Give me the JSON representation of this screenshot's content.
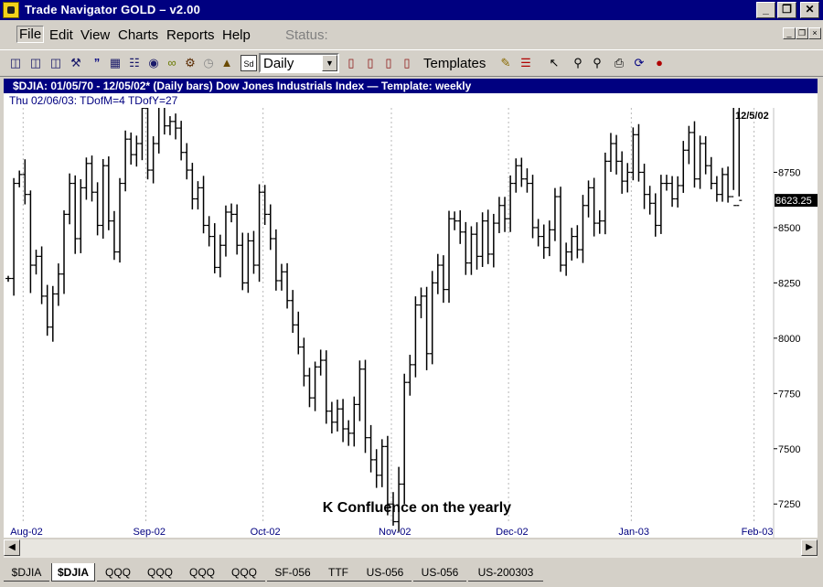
{
  "window": {
    "title": "Trade Navigator GOLD – v2.00"
  },
  "menu": {
    "items": [
      "File",
      "Edit",
      "View",
      "Charts",
      "Reports",
      "Help"
    ],
    "status_label": "Status:"
  },
  "toolbar": {
    "period_value": "Daily",
    "templates_label": "Templates",
    "icons": [
      "zoom-in-icon",
      "zoom-out-icon",
      "zoom-fit-icon",
      "tools-icon",
      "quotes-icon",
      "grid-icon",
      "print-preview-icon",
      "camera-icon",
      "link-icon",
      "gear-icon",
      "clock-icon",
      "hat-icon",
      "sd-icon",
      "bars-1-icon",
      "bars-2-icon",
      "bars-3-icon",
      "bars-4-icon",
      "pencil-icon",
      "lines-icon",
      "cursor-icon",
      "magnify-plus-icon",
      "magnify-minus-icon",
      "printer-icon",
      "refresh-icon",
      "traffic-light-icon"
    ]
  },
  "chart_header": {
    "title": "$DJIA:  01/05/70 - 12/05/02*  (Daily bars)   Dow Jones Industrials Index  —  Template: weekly",
    "info": "Thu   02/06/03:  TDofM=4   TDofY=27"
  },
  "chart_data": {
    "type": "ohlc",
    "title": "",
    "xlabel": "",
    "ylabel": "",
    "ylim": [
      7160,
      9000
    ],
    "yticks": [
      7250,
      7500,
      7750,
      8000,
      8250,
      8500,
      8750
    ],
    "xticks": [
      {
        "label": "Aug-02",
        "bar": 3
      },
      {
        "label": "Sep-02",
        "bar": 25
      },
      {
        "label": "Oct-02",
        "bar": 46
      },
      {
        "label": "Nov-02",
        "bar": 69
      },
      {
        "label": "Dec-02",
        "bar": 90
      },
      {
        "label": "Jan-03",
        "bar": 112
      },
      {
        "label": "Feb-03",
        "bar": 134
      }
    ],
    "x_total_bars": 138,
    "last_date_label": "12/5/02",
    "last_price": "8623.25",
    "annotation": {
      "text": "K      Confluence on the  yearly",
      "bar": 57
    },
    "grid": true,
    "closes": [
      8270,
      8700,
      8740,
      8650,
      8330,
      8370,
      8190,
      8050,
      8200,
      8290,
      8560,
      8700,
      8450,
      8680,
      8790,
      8660,
      8510,
      8780,
      8530,
      8390,
      8700,
      8900,
      8830,
      8880,
      9040,
      8760,
      8880,
      9090,
      8960,
      8980,
      8950,
      8840,
      8760,
      8630,
      8680,
      8510,
      8460,
      8320,
      8420,
      8570,
      8560,
      8420,
      8250,
      8440,
      8330,
      8660,
      8560,
      8450,
      8260,
      8300,
      8170,
      8060,
      7960,
      7830,
      7730,
      7870,
      7900,
      7670,
      7620,
      7680,
      7590,
      7570,
      7700,
      7860,
      7550,
      7450,
      7380,
      7510,
      7250,
      7170,
      7340,
      7800,
      7880,
      8150,
      8190,
      7930,
      8250,
      8330,
      8220,
      8540,
      8530,
      8480,
      8340,
      8470,
      8370,
      8530,
      8380,
      8520,
      8600,
      8540,
      8700,
      8780,
      8720,
      8700,
      8500,
      8460,
      8410,
      8490,
      8640,
      8330,
      8390,
      8460,
      8400,
      8600,
      8680,
      8520,
      8530,
      8800,
      8880,
      8800,
      8710,
      8750,
      8920,
      8750,
      8650,
      8610,
      8510,
      8700,
      8700,
      8630,
      8690,
      8850,
      8930,
      8720,
      8880,
      8780,
      8700,
      8650,
      8740,
      8640,
      8600,
      8623
    ],
    "lows_offset": [
      50,
      260,
      60,
      150,
      420,
      140,
      120,
      130,
      220,
      180,
      300,
      150,
      230,
      220,
      180,
      140,
      150,
      200,
      140,
      120,
      160,
      120,
      150,
      180,
      250,
      140,
      200,
      150,
      130,
      140,
      170,
      120,
      140,
      160,
      160,
      120,
      150,
      90,
      150,
      170,
      120,
      140,
      110,
      150,
      130,
      250,
      160,
      170,
      150,
      150,
      120,
      120,
      110,
      160,
      140,
      200,
      130,
      190,
      170,
      140,
      200,
      190,
      200,
      250,
      230,
      190,
      190,
      180,
      170,
      60,
      150,
      300,
      200,
      190,
      200,
      250,
      160,
      170,
      200,
      200,
      140,
      180,
      180,
      180,
      200,
      160,
      150,
      200,
      150,
      200,
      200,
      140,
      120,
      140,
      160,
      150,
      170,
      130,
      170,
      100,
      160,
      130,
      130,
      200,
      180,
      200,
      160,
      200,
      160,
      200,
      190,
      170,
      120,
      140,
      220,
      170,
      170,
      130,
      110,
      120,
      130,
      110,
      210,
      130,
      150,
      130,
      90,
      110,
      110,
      90
    ],
    "highs_offset": [
      40,
      80,
      60,
      230,
      60,
      100,
      150,
      170,
      120,
      160,
      60,
      150,
      120,
      130,
      90,
      120,
      150,
      100,
      140,
      150,
      80,
      130,
      100,
      120,
      50,
      160,
      110,
      80,
      150,
      80,
      120,
      110,
      140,
      110,
      100,
      180,
      140,
      200,
      160,
      100,
      130,
      150,
      190,
      120,
      150,
      120,
      110,
      150,
      140,
      120,
      130,
      160,
      200,
      140,
      120,
      80,
      160,
      150,
      140,
      140,
      150,
      130,
      120,
      130,
      140,
      190,
      160,
      110,
      160,
      180,
      260,
      130,
      150,
      130,
      130,
      140,
      180,
      170,
      150,
      120,
      110,
      160,
      150,
      120,
      180,
      130,
      170,
      140,
      130,
      130,
      120,
      110,
      120,
      160,
      130,
      130,
      180,
      140,
      130,
      150,
      140,
      130,
      170,
      160,
      110,
      150,
      160,
      130,
      160,
      130,
      150,
      140,
      110,
      160,
      130,
      130,
      150,
      130,
      130,
      110,
      140,
      140,
      100,
      170,
      120,
      110,
      130,
      110,
      100,
      120,
      100,
      60
    ]
  },
  "scrollbar": {
    "left_arrow": "◀",
    "right_arrow": "▶"
  },
  "tabs": [
    "$DJIA",
    "$DJIA",
    "QQQ",
    "QQQ",
    "QQQ",
    "QQQ",
    "SF-056",
    "TTF",
    "US-056",
    "US-056",
    "US-200303"
  ],
  "active_tab": 1
}
